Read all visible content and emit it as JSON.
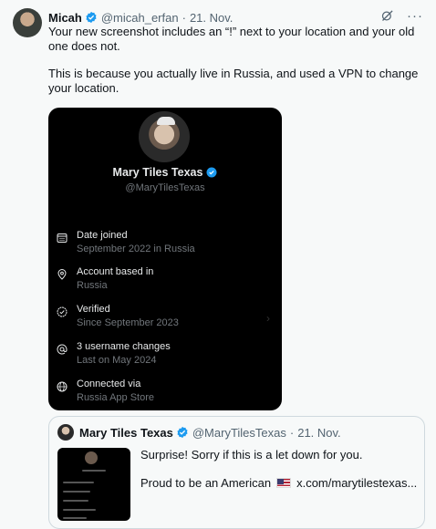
{
  "tweet": {
    "author_name": "Micah",
    "handle": "@micah_erfan",
    "separator": "·",
    "time": "21. Nov.",
    "more_icon": "···",
    "text_p1": "Your new screenshot includes an “!” next to your location and your old one does not.",
    "text_p2": "This is because you actually live in Russia, and used a VPN to change your location."
  },
  "media": {
    "profile_name": "Mary Tiles Texas",
    "profile_handle": "@MaryTilesTexas",
    "rows": [
      {
        "label": "Date joined",
        "sub": "September 2022 in Russia",
        "icon": "calendar-icon"
      },
      {
        "label": "Account based in",
        "sub": "Russia",
        "icon": "location-pin-icon"
      },
      {
        "label": "Verified",
        "sub": "Since September 2023",
        "icon": "verified-check-icon"
      },
      {
        "label": "3 username changes",
        "sub": "Last on May 2024",
        "icon": "at-sign-icon"
      },
      {
        "label": "Connected via",
        "sub": "Russia App Store",
        "icon": "globe-icon"
      }
    ],
    "chevron": "›"
  },
  "quote": {
    "author_name": "Mary Tiles Texas",
    "handle": "@MaryTilesTexas",
    "separator": "·",
    "time": "21. Nov.",
    "line1": "Surprise! Sorry if this is a let down for you.",
    "line2_text": "Proud to be an American",
    "flag_icon": "us-flag-icon",
    "link": "x.com/marytilestexas..."
  },
  "colors": {
    "verified_blue": "#1d9bf0",
    "text_secondary": "#536471",
    "media_bg": "#000000"
  }
}
